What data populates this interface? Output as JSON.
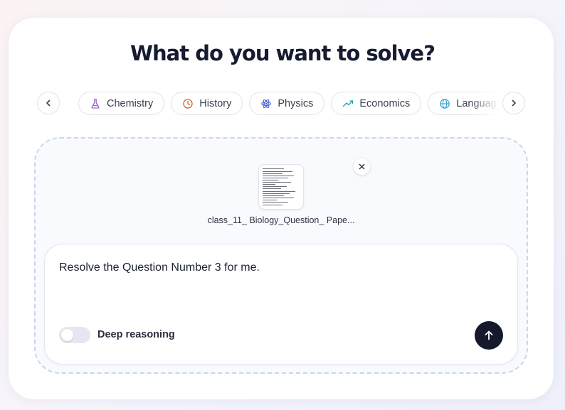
{
  "header": {
    "title": "What do you want to solve?"
  },
  "subjects": [
    {
      "label": "Chemistry",
      "icon": "flask-icon",
      "color": "#a35dd6"
    },
    {
      "label": "History",
      "icon": "clock-icon",
      "color": "#c46a2b"
    },
    {
      "label": "Physics",
      "icon": "atom-icon",
      "color": "#4a63d6"
    },
    {
      "label": "Economics",
      "icon": "trend-up-icon",
      "color": "#1aa3a8"
    },
    {
      "label": "Languages",
      "icon": "globe-icon",
      "color": "#2b9fd6"
    }
  ],
  "nav": {
    "prev_icon": "chevron-left-icon",
    "next_icon": "chevron-right-icon"
  },
  "attachment": {
    "filename": "class_11_ Biology_Question_ Pape...",
    "remove_icon": "close-icon"
  },
  "composer": {
    "prompt": "Resolve the Question Number 3 for me.",
    "deep_reasoning_label": "Deep reasoning",
    "deep_reasoning_enabled": false,
    "send_icon": "arrow-up-icon"
  },
  "colors": {
    "accent": "#141a2c",
    "dashed_border": "#c9d6ef"
  }
}
